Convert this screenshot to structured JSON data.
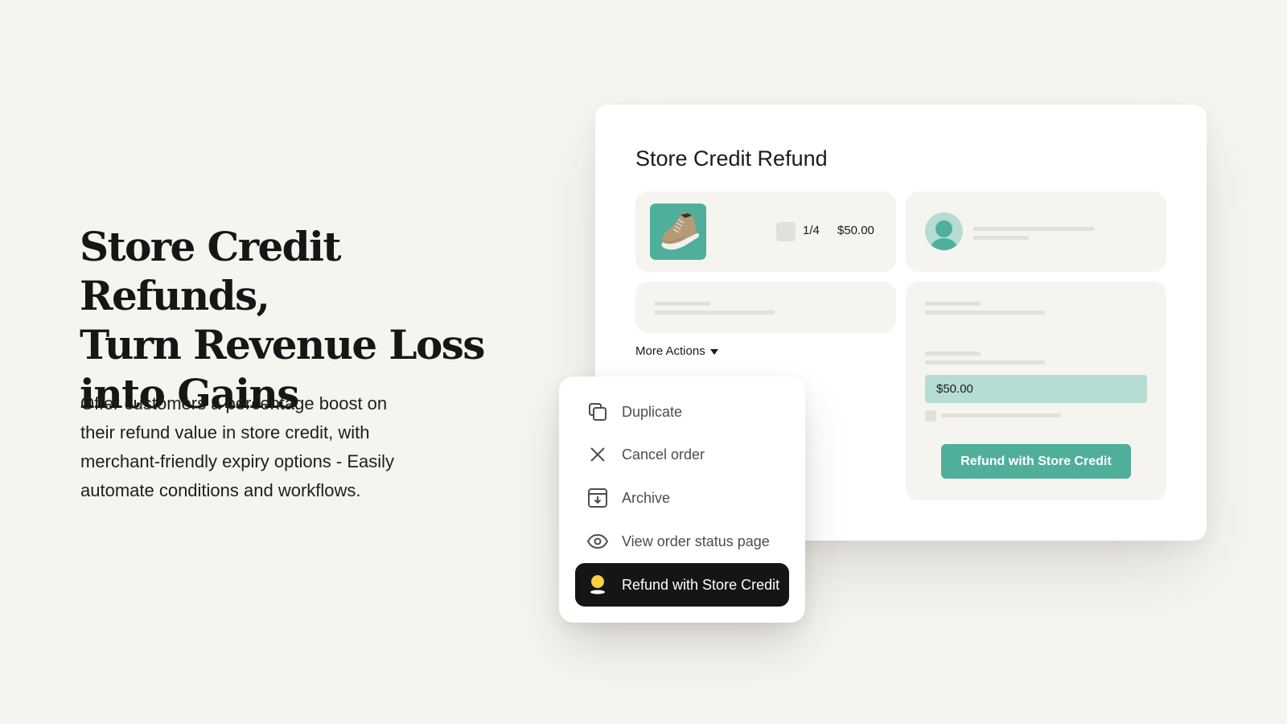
{
  "hero": {
    "title_lines": [
      "Store Credit Refunds,",
      "Turn Revenue Loss",
      "into Gains"
    ],
    "description_lines": [
      "Offer customers a percentage boost on",
      "their refund value in store credit, with",
      "merchant-friendly expiry options - Easily",
      "automate conditions and workflows."
    ]
  },
  "card": {
    "title": "Store Credit Refund",
    "line_item": {
      "image": "hiking-boot-icon",
      "quantity": "1/4",
      "price": "$50.00"
    },
    "customer": {
      "avatar": "user-avatar-icon"
    },
    "refund": {
      "amount": "$50.00",
      "button_label": "Refund with Store Credit"
    },
    "more_actions_label": "More Actions"
  },
  "menu": {
    "items": [
      {
        "label": "Duplicate",
        "icon": "duplicate-icon"
      },
      {
        "label": "Cancel order",
        "icon": "close-icon"
      },
      {
        "label": "Archive",
        "icon": "archive-icon"
      },
      {
        "label": "View order status page",
        "icon": "eye-icon"
      },
      {
        "label": "Refund with Store Credit",
        "icon": "store-credit-icon",
        "highlighted": true
      }
    ]
  },
  "colors": {
    "background": "#f5f4ef",
    "accent": "#4faf9b",
    "accent_light": "#b5ddd4",
    "highlight_bg": "#151515",
    "coin_yellow": "#f7cf45"
  }
}
